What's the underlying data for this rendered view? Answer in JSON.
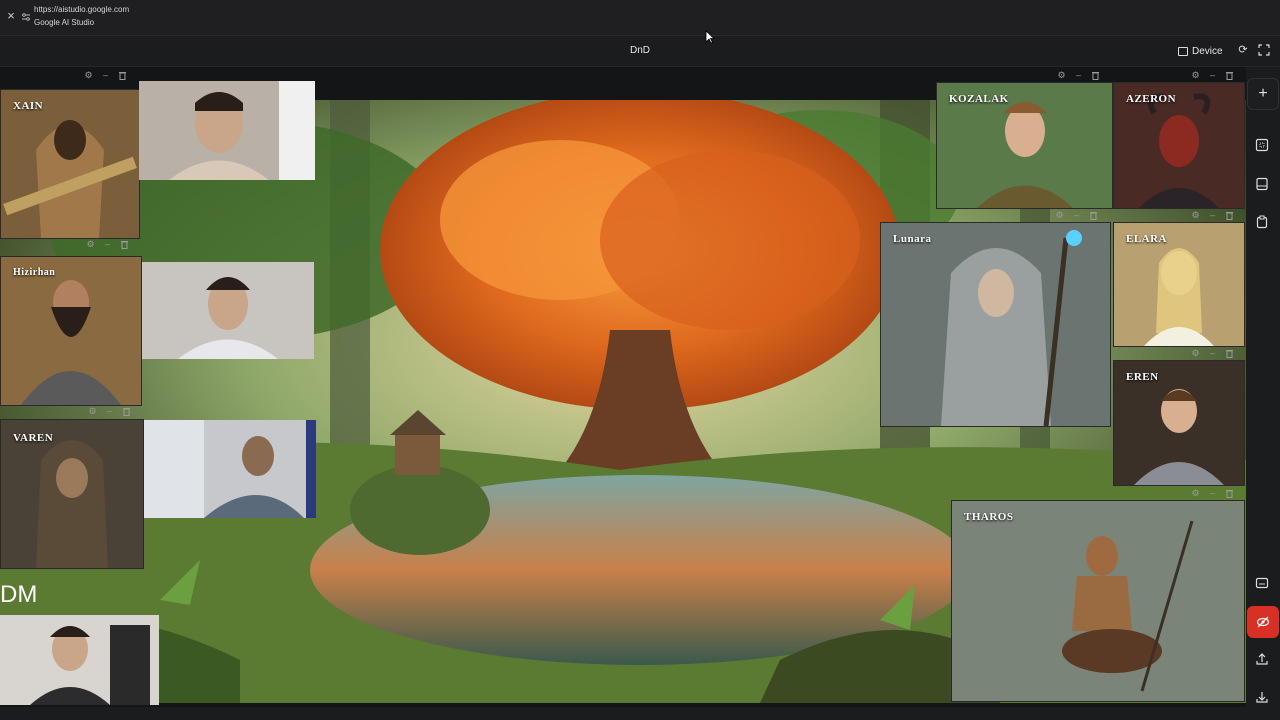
{
  "browser": {
    "url": "https://aistudio.google.com",
    "site_name": "Google AI Studio"
  },
  "app": {
    "title": "DnD",
    "device_label": "Device"
  },
  "characters": [
    {
      "name": "XAIN"
    },
    {
      "name": "Hizirhan"
    },
    {
      "name": "VAREN"
    },
    {
      "name": "KOZALAK"
    },
    {
      "name": "AZERON"
    },
    {
      "name": "Lunara"
    },
    {
      "name": "ELARA"
    },
    {
      "name": "EREN"
    },
    {
      "name": "THAROS"
    }
  ],
  "dm_label": "DM",
  "icons": {
    "close": "×",
    "refresh": "⟳",
    "add": "+",
    "settings": "⚙",
    "minimize": "–",
    "delete": "🗑"
  },
  "colors": {
    "accent_red": "#d93025",
    "panel_bg": "#1b1c1e"
  }
}
